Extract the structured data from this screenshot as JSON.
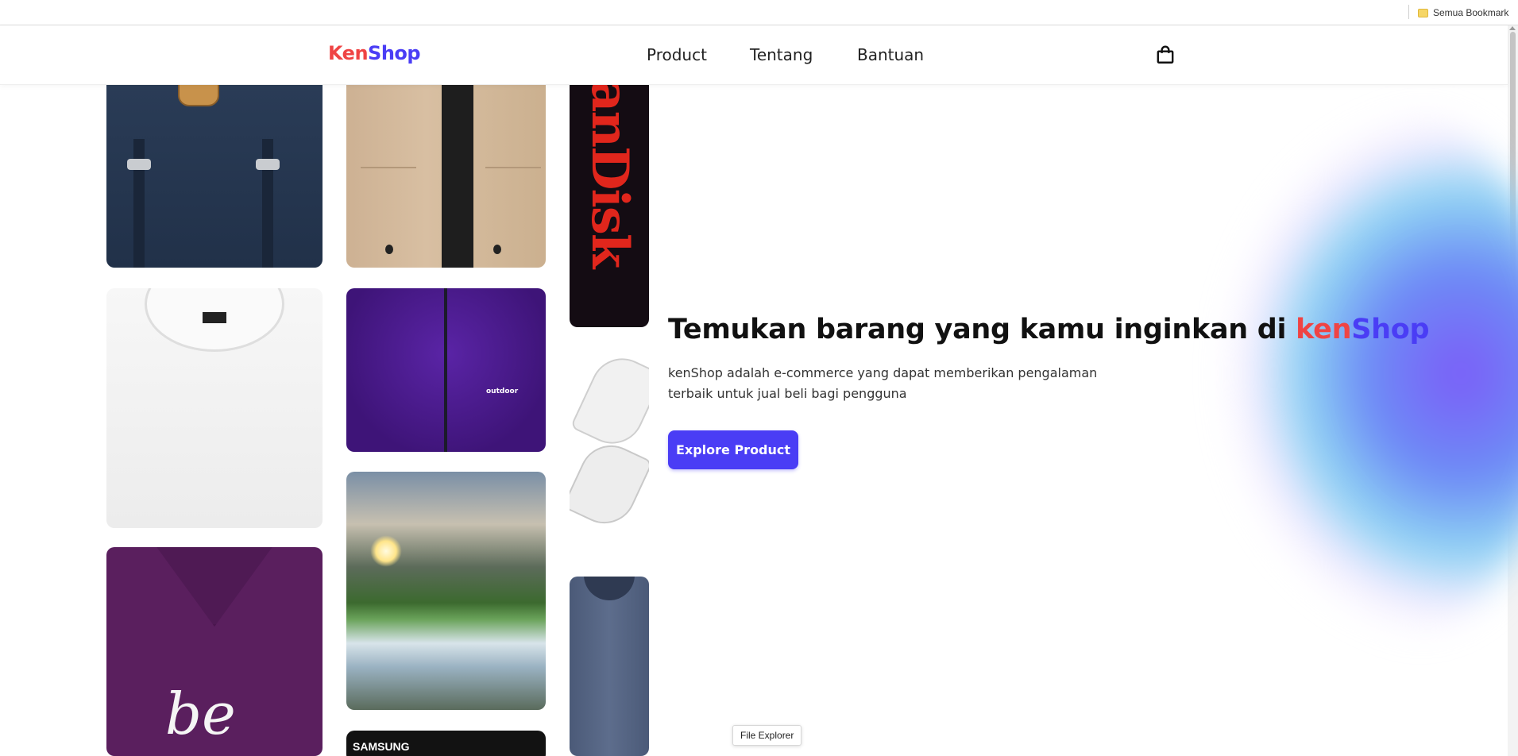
{
  "bookmark_bar": {
    "item_label": "Semua Bookmark"
  },
  "navbar": {
    "logo": {
      "part1": "Ken",
      "part2": "Shop"
    },
    "links": [
      {
        "label": "Product"
      },
      {
        "label": "Tentang"
      },
      {
        "label": "Bantuan"
      }
    ],
    "cart_icon": "shopping-bag-icon"
  },
  "product_tiles": [
    {
      "name": "backpack"
    },
    {
      "name": "jacket"
    },
    {
      "name": "sandisk-card",
      "text": "anDisk"
    },
    {
      "name": "white-tshirt"
    },
    {
      "name": "purple-fleece-jacket",
      "text": "outdoor"
    },
    {
      "name": "waterfall-photo"
    },
    {
      "name": "white-sneakers"
    },
    {
      "name": "purple-tshirt",
      "text": "be"
    },
    {
      "name": "blue-shirt"
    },
    {
      "name": "samsung-product",
      "text": "SAMSUNG"
    }
  ],
  "hero": {
    "title_prefix": "Temukan barang yang kamu inginkan di ",
    "title_ken": "ken",
    "title_shop": "Shop",
    "description_line1": "kenShop adalah e-commerce yang dapat memberikan pengalaman",
    "description_line2": "terbaik untuk jual beli bagi pengguna",
    "cta_label": "Explore Product"
  },
  "tooltip": {
    "text": "File Explorer"
  },
  "colors": {
    "brand_red": "#ef4444",
    "brand_blue": "#4a3df5",
    "button_bg": "#4a3df5"
  }
}
